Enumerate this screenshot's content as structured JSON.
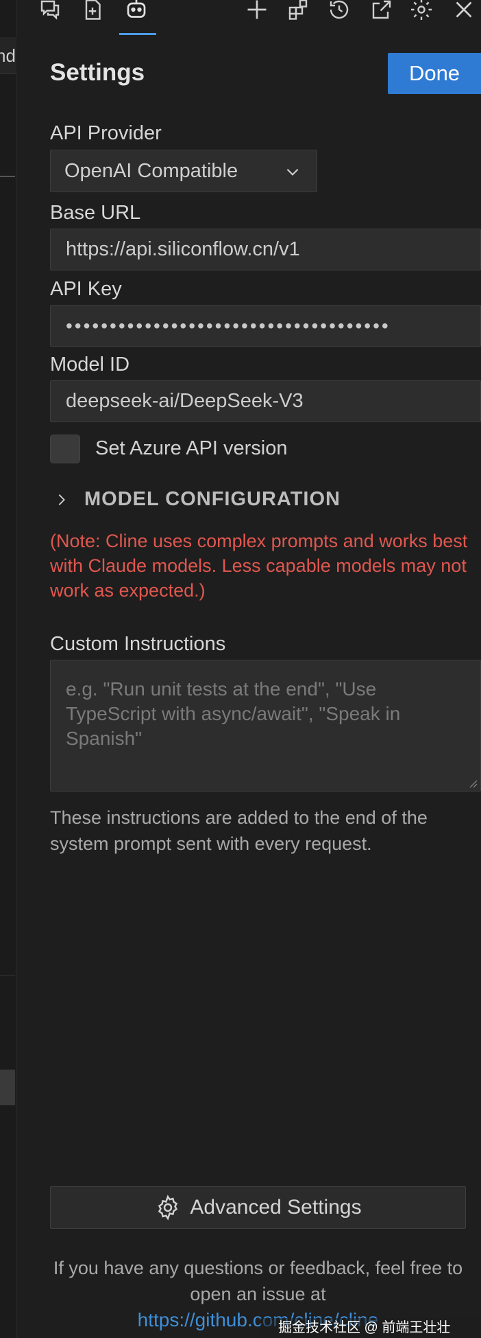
{
  "left_tab_text": "nd",
  "toolbar": {
    "icons": [
      "chat-history-icon",
      "new-file-icon",
      "robot-icon",
      "plus-icon",
      "extensions-icon",
      "history-icon",
      "external-link-icon",
      "gear-icon",
      "close-icon"
    ],
    "active_icon": "robot-icon",
    "accent": "#4c9be8"
  },
  "header": {
    "title": "Settings",
    "done_label": "Done"
  },
  "api_provider": {
    "label": "API Provider",
    "selected": "OpenAI Compatible"
  },
  "base_url": {
    "label": "Base URL",
    "value": "https://api.siliconflow.cn/v1"
  },
  "api_key": {
    "label": "API Key",
    "value": "•••••••••••••••••••••••••••••••••••••"
  },
  "model_id": {
    "label": "Model ID",
    "value": "deepseek-ai/DeepSeek-V3"
  },
  "azure": {
    "label": "Set Azure API version",
    "checked": false
  },
  "model_config": {
    "label": "MODEL CONFIGURATION",
    "expanded": false
  },
  "note": "(Note: Cline uses complex prompts and works best with Claude models. Less capable models may not work as expected.)",
  "custom_instructions": {
    "label": "Custom Instructions",
    "placeholder": "e.g. \"Run unit tests at the end\", \"Use TypeScript with async/await\", \"Speak in Spanish\"",
    "help": "These instructions are added to the end of the system prompt sent with every request."
  },
  "advanced": {
    "label": "Advanced Settings"
  },
  "footer": {
    "text": "If you have any questions or feedback, feel free to open an issue at",
    "link": "https://github.com/cline/cline"
  },
  "watermark": "掘金技术社区 @ 前端王壮壮",
  "colors": {
    "done_bg": "#2f7bd4",
    "note": "#e0574f",
    "link": "#3f8fd8"
  }
}
